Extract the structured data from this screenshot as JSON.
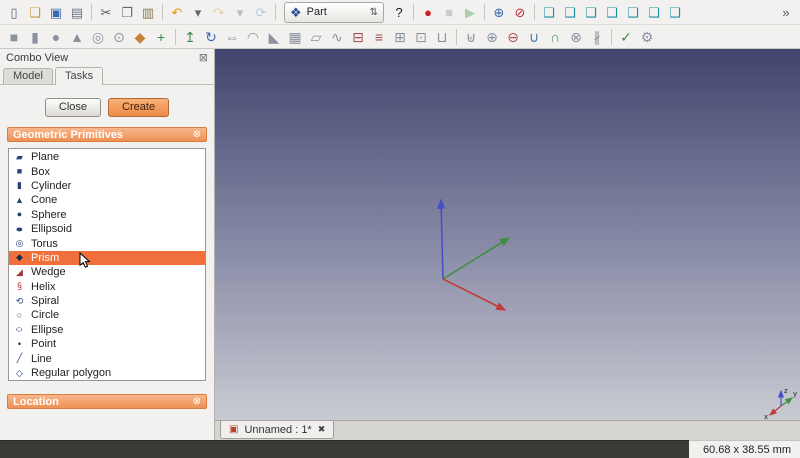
{
  "colors": {
    "accent": "#f0703c",
    "viewport_top": "#41446d",
    "viewport_mid": "#8a8da8",
    "viewport_bottom": "#c9cbd2",
    "axis_x": "#c23b3b",
    "axis_y": "#3f8f3f",
    "axis_z": "#4450c8",
    "section_header": "#ee9154",
    "workbench_cube": "#2a4a9a",
    "view_cube": "#1f8fa0"
  },
  "toolbar": {
    "workbench_selector": "Part",
    "workbench_icon_glyph": "❖",
    "combo_arrows_glyph": "⇅",
    "row1": [
      {
        "name": "new-file",
        "glyph": "▯",
        "color": "#5a6a7a"
      },
      {
        "name": "open-file",
        "glyph": "❏",
        "color": "#c8983a"
      },
      {
        "name": "save",
        "glyph": "▣",
        "color": "#3a6ab0"
      },
      {
        "name": "print",
        "glyph": "▤",
        "color": "#6a7686"
      },
      {
        "sep": true
      },
      {
        "name": "cut",
        "glyph": "✂",
        "color": "#555555"
      },
      {
        "name": "copy",
        "glyph": "❐",
        "color": "#5a6a7a"
      },
      {
        "name": "paste",
        "glyph": "▥",
        "color": "#8a7a50"
      },
      {
        "sep": true
      },
      {
        "name": "undo",
        "glyph": "↶",
        "color": "#d89a20"
      },
      {
        "name": "undo-menu",
        "glyph": "▾",
        "color": "#666666"
      },
      {
        "name": "redo",
        "glyph": "↷",
        "color": "#d89a20",
        "disabled": true
      },
      {
        "name": "redo-menu",
        "glyph": "▾",
        "color": "#666666",
        "disabled": true
      },
      {
        "name": "refresh",
        "glyph": "⟳",
        "color": "#5a8ac0",
        "disabled": true
      },
      {
        "sep": true
      },
      {
        "combo": true
      },
      {
        "name": "whats-this",
        "glyph": "?",
        "color": "#1a1a1a"
      },
      {
        "sep": true
      },
      {
        "name": "macro-record",
        "glyph": "●",
        "color": "#cc2020"
      },
      {
        "name": "macro-stop",
        "glyph": "■",
        "color": "#909090",
        "disabled": true
      },
      {
        "name": "macro-execute",
        "glyph": "▶",
        "color": "#3a9a3a",
        "disabled": true
      },
      {
        "sep": true
      },
      {
        "name": "fit-all",
        "glyph": "⊕",
        "color": "#3a6ab0"
      },
      {
        "name": "draw-style",
        "glyph": "⊘",
        "color": "#c03030"
      },
      {
        "sep": true
      },
      {
        "name": "view-axonometric",
        "glyph": "❑",
        "color": "#1f8fa0"
      },
      {
        "name": "view-front",
        "glyph": "❑",
        "color": "#1f8fa0"
      },
      {
        "name": "view-top",
        "glyph": "❑",
        "color": "#1f8fa0"
      },
      {
        "name": "view-right",
        "glyph": "❑",
        "color": "#1f8fa0"
      },
      {
        "name": "view-rear",
        "glyph": "❑",
        "color": "#1f8fa0"
      },
      {
        "name": "view-bottom",
        "glyph": "❑",
        "color": "#1f8fa0"
      },
      {
        "name": "view-left",
        "glyph": "❑",
        "color": "#1f8fa0"
      },
      {
        "spacer": true
      },
      {
        "name": "toolbar-overflow",
        "glyph": "»",
        "color": "#555555"
      }
    ],
    "row2": [
      {
        "name": "box",
        "glyph": "■",
        "color": "#8a92a0"
      },
      {
        "name": "cylinder",
        "glyph": "▮",
        "color": "#8a92a0"
      },
      {
        "name": "sphere",
        "glyph": "●",
        "color": "#8a92a0"
      },
      {
        "name": "cone",
        "glyph": "▲",
        "color": "#8a92a0"
      },
      {
        "name": "torus",
        "glyph": "◎",
        "color": "#8a92a0"
      },
      {
        "name": "tube",
        "glyph": "⊙",
        "color": "#8a92a0"
      },
      {
        "name": "create-primitives",
        "glyph": "◆",
        "color": "#c8803a"
      },
      {
        "name": "shape-builder",
        "glyph": "+",
        "color": "#3a8a4a"
      },
      {
        "sep": true
      },
      {
        "name": "extrude",
        "glyph": "↥",
        "color": "#3a8a4a"
      },
      {
        "name": "revolve",
        "glyph": "↻",
        "color": "#3a6ab0"
      },
      {
        "name": "mirror",
        "glyph": "⇔",
        "color": "#8a92a0"
      },
      {
        "name": "fillet",
        "glyph": "◠",
        "color": "#8a92a0"
      },
      {
        "name": "chamfer",
        "glyph": "◣",
        "color": "#8a92a0"
      },
      {
        "name": "ruled-surface",
        "glyph": "▦",
        "color": "#8a92a0"
      },
      {
        "name": "loft",
        "glyph": "▱",
        "color": "#8a92a0"
      },
      {
        "name": "sweep",
        "glyph": "∿",
        "color": "#8a92a0"
      },
      {
        "name": "section",
        "glyph": "⊟",
        "color": "#a05050"
      },
      {
        "name": "cross-sections",
        "glyph": "≡",
        "color": "#a05050"
      },
      {
        "name": "offset-3d",
        "glyph": "⊞",
        "color": "#8a92a0"
      },
      {
        "name": "offset-2d",
        "glyph": "⊡",
        "color": "#8a92a0"
      },
      {
        "name": "thickness",
        "glyph": "⊔",
        "color": "#8a92a0"
      },
      {
        "sep": true
      },
      {
        "name": "compound",
        "glyph": "⊎",
        "color": "#8a92a0"
      },
      {
        "name": "boolean",
        "glyph": "⊕",
        "color": "#8a92a0"
      },
      {
        "name": "cut-boolean",
        "glyph": "⊖",
        "color": "#b05050"
      },
      {
        "name": "union",
        "glyph": "∪",
        "color": "#4a7ab0"
      },
      {
        "name": "intersection",
        "glyph": "∩",
        "color": "#4a9a4a"
      },
      {
        "name": "join-connect",
        "glyph": "⊗",
        "color": "#8a92a0"
      },
      {
        "name": "split",
        "glyph": "∦",
        "color": "#8a92a0"
      },
      {
        "sep": true
      },
      {
        "name": "check-geometry",
        "glyph": "✓",
        "color": "#3a8a3a"
      },
      {
        "name": "defeaturing",
        "glyph": "⚙",
        "color": "#8a92a0"
      }
    ]
  },
  "combo_view": {
    "title": "Combo View",
    "dock_glyph": "⊠",
    "tabs": [
      {
        "label": "Model",
        "active": false
      },
      {
        "label": "Tasks",
        "active": true
      }
    ],
    "task_buttons": {
      "close": "Close",
      "create": "Create"
    },
    "sections": [
      {
        "title": "Geometric Primitives",
        "close_glyph": "⊗"
      },
      {
        "title": "Location",
        "close_glyph": "⊗"
      }
    ],
    "primitives": [
      {
        "label": "Plane",
        "glyph": "▰",
        "color": "#27427c"
      },
      {
        "label": "Box",
        "glyph": "■",
        "color": "#27427c"
      },
      {
        "label": "Cylinder",
        "glyph": "▮",
        "color": "#27427c"
      },
      {
        "label": "Cone",
        "glyph": "▲",
        "color": "#27427c"
      },
      {
        "label": "Sphere",
        "glyph": "●",
        "color": "#27427c"
      },
      {
        "label": "Ellipsoid",
        "glyph": "●",
        "color": "#27427c",
        "cls": "wide"
      },
      {
        "label": "Torus",
        "glyph": "◎",
        "color": "#27427c"
      },
      {
        "label": "Prism",
        "glyph": "◆",
        "color": "#1b2c54",
        "selected": true
      },
      {
        "label": "Wedge",
        "glyph": "◢",
        "color": "#9a3a3a"
      },
      {
        "label": "Helix",
        "glyph": "§",
        "color": "#b03030"
      },
      {
        "label": "Spiral",
        "glyph": "⟲",
        "color": "#27427c"
      },
      {
        "label": "Circle",
        "glyph": "○",
        "color": "#27427c"
      },
      {
        "label": "Ellipse",
        "glyph": "○",
        "color": "#27427c",
        "cls": "wide"
      },
      {
        "label": "Point",
        "glyph": "•",
        "color": "#222222"
      },
      {
        "label": "Line",
        "glyph": "╱",
        "color": "#27427c"
      },
      {
        "label": "Regular polygon",
        "glyph": "◇",
        "color": "#27427c"
      }
    ]
  },
  "viewport": {
    "axis_labels": [
      "x",
      "y",
      "z"
    ]
  },
  "document_tab": {
    "icon_glyph": "▣",
    "label": "Unnamed : 1*",
    "close_glyph": "✖"
  },
  "statusbar": {
    "dimensions": "60.68 x 38.55 mm"
  }
}
